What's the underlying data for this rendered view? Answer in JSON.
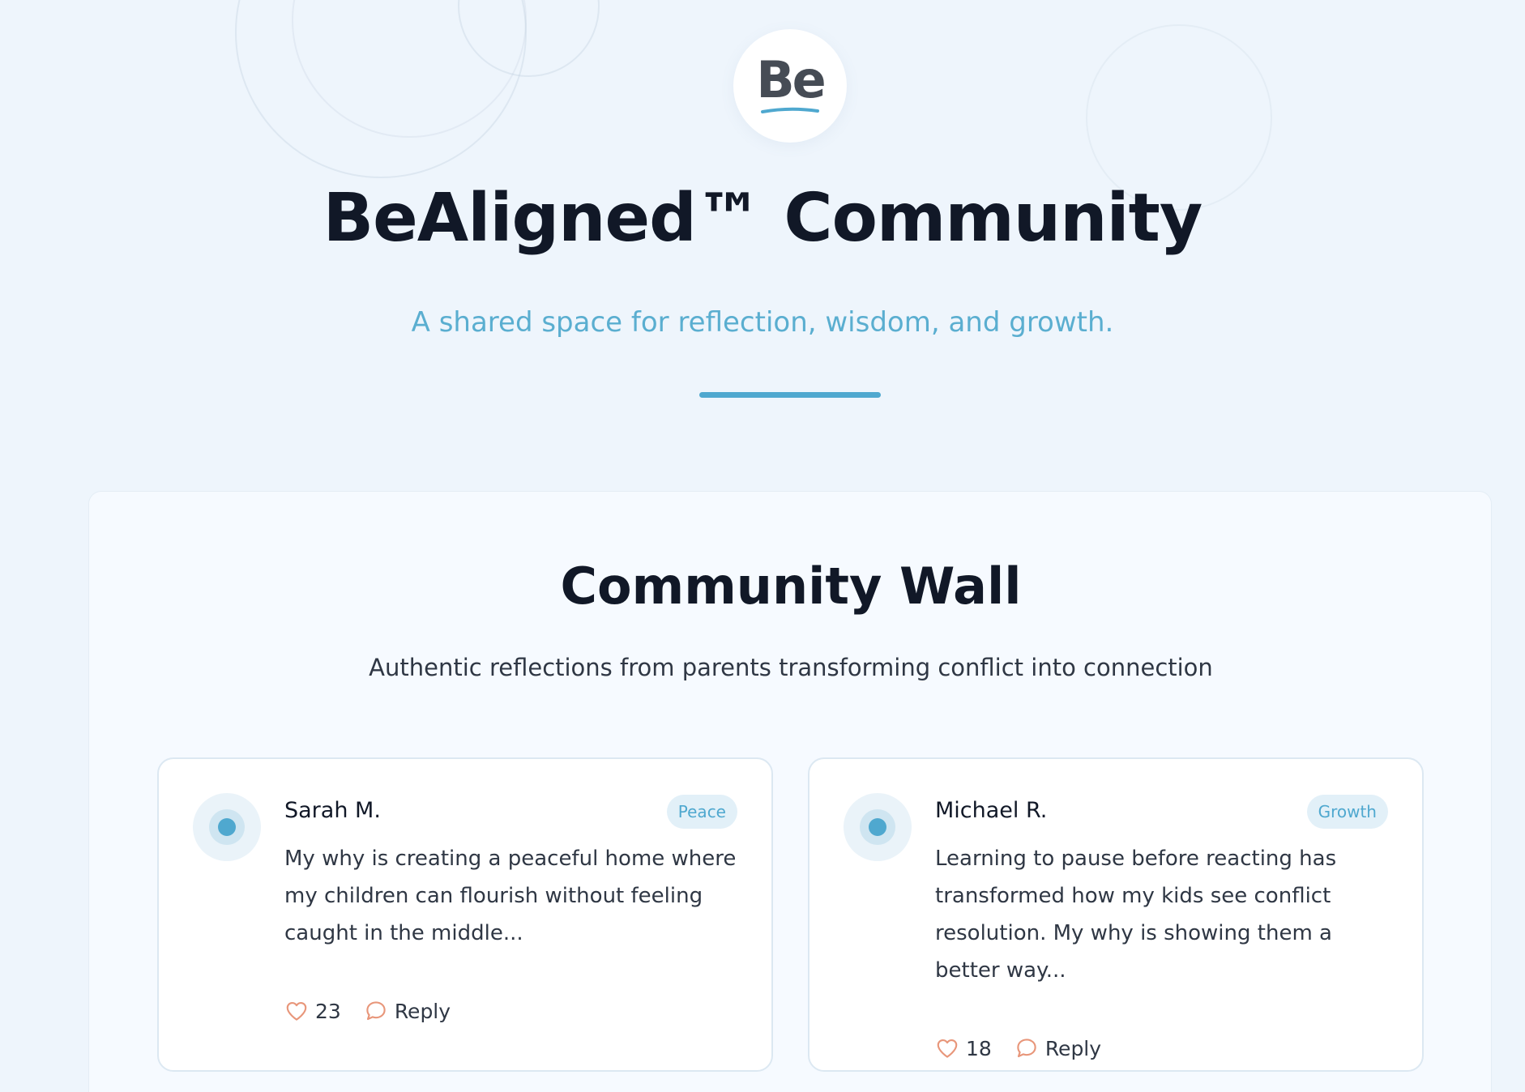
{
  "header": {
    "logo_text": "Be",
    "title": "BeAligned™ Community",
    "tagline": "A shared space for reflection, wisdom, and growth."
  },
  "wall": {
    "title": "Community Wall",
    "subtitle": "Authentic reflections from parents transforming conflict into connection",
    "posts": [
      {
        "author": "Sarah M.",
        "tag": "Peace",
        "text": "My why is creating a peaceful home where my children can flourish without feeling caught in the middle...",
        "likes": "23",
        "reply_label": "Reply"
      },
      {
        "author": "Michael R.",
        "tag": "Growth",
        "text": "Learning to pause before reacting has transformed how my kids see conflict resolution. My why is showing them a better way...",
        "likes": "18",
        "reply_label": "Reply"
      }
    ]
  },
  "colors": {
    "accent": "#4fa8cf",
    "icon_action": "#e8967a",
    "background": "#eef5fc"
  },
  "icons": {
    "like": "heart-icon",
    "reply": "speech-bubble-icon",
    "avatar": "dot-avatar-icon"
  }
}
